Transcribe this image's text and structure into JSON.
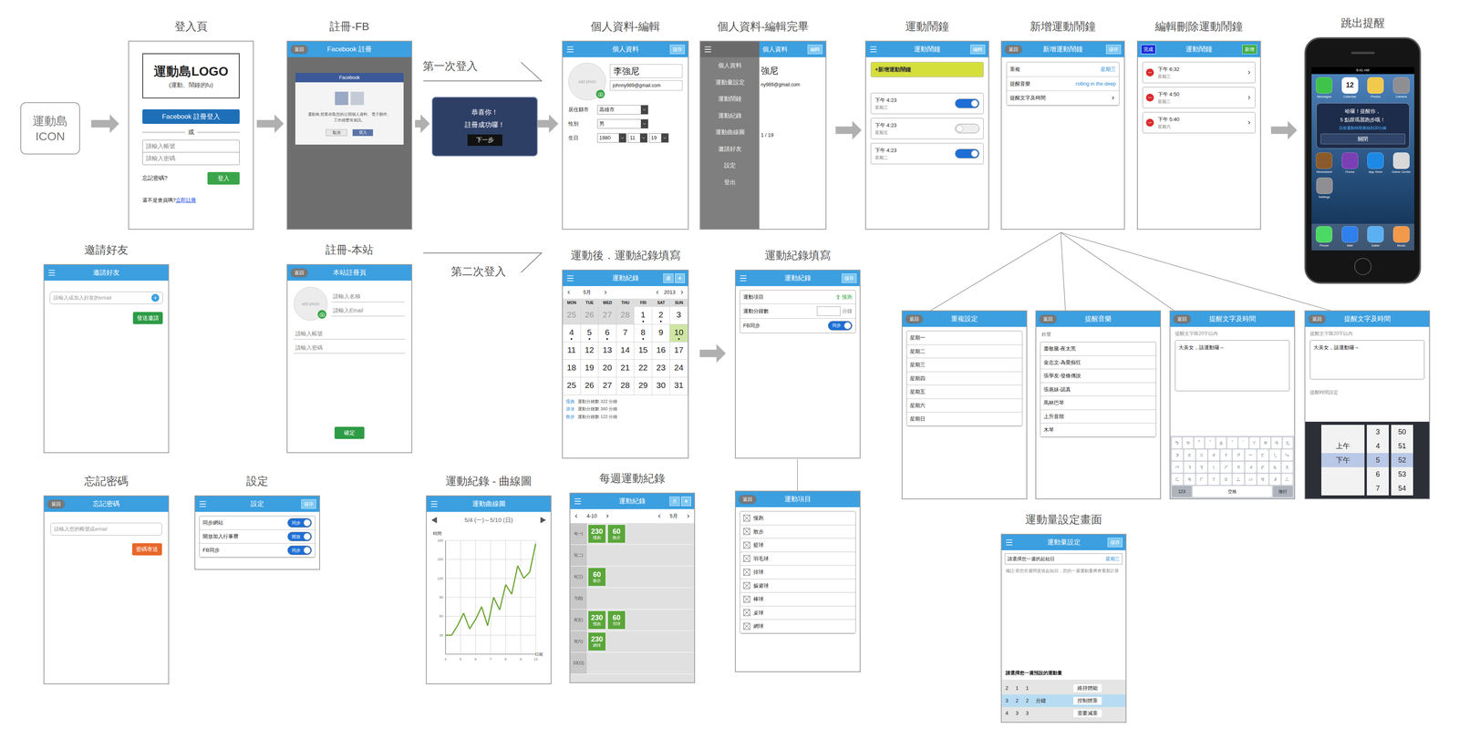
{
  "icon_box": {
    "lines": [
      "運動島",
      "ICON"
    ]
  },
  "flow_labels": [
    "第一次登入",
    "第二次登入"
  ],
  "login": {
    "caption": "登入頁",
    "logo": "運動島LOGO",
    "slogan": "(運動、鬧鐘的fu)",
    "fb_button": "Facebook 註冊登入",
    "divider": "或",
    "account_placeholder": "請輸入帳號",
    "password_placeholder": "請輸入密碼",
    "forgot": "忘記密碼?",
    "login_button": "登入",
    "not_member": "還不是會員嗎?",
    "register_link": "立即註冊"
  },
  "fb_register": {
    "caption": "註冊-FB",
    "back": "返回",
    "header": "Facebook 註冊",
    "dialog_title": "Facebook",
    "dialog_text": "運動島 想要存取您的公開個人資料、電子郵件、工作經歷等資訊。",
    "cancel": "取消",
    "confirm": "登入"
  },
  "success": {
    "lines": [
      "恭喜你！",
      "註冊成功囉！"
    ],
    "button": "下一步"
  },
  "profile_edit": {
    "caption": "個人資料-編輯",
    "header": "個人資料",
    "right_button": "儲存",
    "photo": "add photo",
    "name": "李強尼",
    "email": "johnny989@gmail.com",
    "fields": [
      {
        "label": "居住縣市",
        "value": "高雄市"
      },
      {
        "label": "性別",
        "value": "男"
      }
    ],
    "birthday_label": "生日",
    "birthday": [
      "1980",
      "11",
      "19"
    ]
  },
  "profile_done": {
    "caption": "個人資料-編輯完畢",
    "header": "個人資料",
    "right_button": "編輯",
    "menu": [
      "個人資料",
      "運動量設定",
      "運動鬧鐘",
      "運動紀錄",
      "運動曲線圖",
      "邀請好友",
      "設定",
      "登出"
    ],
    "name": "強尼",
    "email": "ny989@gmail.com",
    "birthday": "1 / 19"
  },
  "alarm": {
    "caption": "運動鬧鐘",
    "header": "運動鬧鐘",
    "right_button": "編輯",
    "add": "+新增運動鬧鐘",
    "items": [
      {
        "time": "下午 4:23",
        "day": "星期三",
        "on": true
      },
      {
        "time": "下午 4:23",
        "day": "星期五",
        "on": false
      },
      {
        "time": "下午 4:23",
        "day": "星期二",
        "on": true
      }
    ]
  },
  "alarm_new": {
    "caption": "新增運動鬧鐘",
    "back": "返回",
    "header": "新增運動鬧鐘",
    "right_button": "儲存",
    "rows": [
      {
        "label": "重複",
        "value": "星期三"
      },
      {
        "label": "提醒音樂",
        "value": "rolling in the deep"
      },
      {
        "label": "提醒文字及時間",
        "value": ""
      }
    ]
  },
  "alarm_edit": {
    "caption": "編輯刪除運動鬧鐘",
    "left_button": "完成",
    "header": "運動鬧鐘",
    "right_button": "新增",
    "items": [
      {
        "time": "下午 6:32",
        "day": "星期三"
      },
      {
        "time": "下午 4:50",
        "day": "星期二"
      },
      {
        "time": "下午 5:40",
        "day": "星期六"
      }
    ]
  },
  "popup": {
    "caption": "跳出提醒",
    "status_time": "9:41 AM",
    "apps_top": [
      {
        "label": "Messages",
        "color": "#3fc34a",
        "text": ""
      },
      {
        "label": "Calendar",
        "color": "#ffffff",
        "text": "12"
      },
      {
        "label": "Photos",
        "color": "#f2c94c",
        "text": ""
      },
      {
        "label": "Camera",
        "color": "#8e8e93",
        "text": ""
      }
    ],
    "alert": {
      "lines": [
        "哈囉！提醒你，",
        "5 點跟瑪麗跑步哦！"
      ],
      "note": "目前運動時間累積到30分鐘",
      "button": "關閉"
    },
    "apps_mid": [
      {
        "label": "Newsstand",
        "color": "#8b5a2b",
        "text": ""
      },
      {
        "label": "iTunes",
        "color": "#7b3fb5",
        "text": ""
      },
      {
        "label": "App Store",
        "color": "#1e88e5",
        "text": ""
      },
      {
        "label": "Game Center",
        "color": "#d9d9d9",
        "text": ""
      }
    ],
    "apps_bottom": [
      {
        "label": "Settings",
        "color": "#8e8e93",
        "text": ""
      }
    ],
    "dock": [
      {
        "label": "Phone",
        "color": "#4cd964",
        "text": ""
      },
      {
        "label": "Mail",
        "color": "#2f80ed",
        "text": ""
      },
      {
        "label": "Safari",
        "color": "#5ab0f0",
        "text": ""
      },
      {
        "label": "Music",
        "color": "#f2994a",
        "text": ""
      }
    ]
  },
  "invite": {
    "caption": "邀請好友",
    "header": "邀請好友",
    "placeholder": "請輸入或加入好友的email",
    "send": "發送邀請"
  },
  "register_site": {
    "caption": "註冊-本站",
    "back": "返回",
    "header": "本站註冊頁",
    "photo": "add photo",
    "fields": [
      "請輸入名稱",
      "請輸入Email",
      "請輸入帳號",
      "請輸入密碼"
    ],
    "confirm": "確定"
  },
  "calendar": {
    "caption": "運動後．運動紀錄填寫",
    "header": "運動紀錄",
    "right_button": "週",
    "add": "+",
    "month": "5月",
    "year": "2013",
    "weekdays": [
      "MON",
      "TUE",
      "WED",
      "THU",
      "FRI",
      "SAT",
      "SUN"
    ],
    "days": [
      {
        "d": "25",
        "muted": true,
        "dot": false,
        "selected": false
      },
      {
        "d": "26",
        "muted": true,
        "dot": false,
        "selected": false
      },
      {
        "d": "27",
        "muted": true,
        "dot": false,
        "selected": false
      },
      {
        "d": "28",
        "muted": true,
        "dot": false,
        "selected": false
      },
      {
        "d": "1",
        "muted": false,
        "dot": true,
        "selected": false
      },
      {
        "d": "2",
        "muted": false,
        "dot": true,
        "selected": false
      },
      {
        "d": "3",
        "muted": false,
        "dot": false,
        "selected": false
      },
      {
        "d": "4",
        "muted": false,
        "dot": true,
        "selected": false
      },
      {
        "d": "5",
        "muted": false,
        "dot": true,
        "selected": false
      },
      {
        "d": "6",
        "muted": false,
        "dot": true,
        "selected": false
      },
      {
        "d": "7",
        "muted": false,
        "dot": false,
        "selected": false
      },
      {
        "d": "8",
        "muted": false,
        "dot": true,
        "selected": false
      },
      {
        "d": "9",
        "muted": false,
        "dot": false,
        "selected": false
      },
      {
        "d": "10",
        "muted": false,
        "dot": true,
        "selected": true
      },
      {
        "d": "11",
        "muted": false,
        "dot": false,
        "selected": false
      },
      {
        "d": "12",
        "muted": false,
        "dot": false,
        "selected": false
      },
      {
        "d": "13",
        "muted": false,
        "dot": false,
        "selected": false
      },
      {
        "d": "14",
        "muted": false,
        "dot": false,
        "selected": false
      },
      {
        "d": "15",
        "muted": false,
        "dot": false,
        "selected": false
      },
      {
        "d": "16",
        "muted": false,
        "dot": false,
        "selected": false
      },
      {
        "d": "17",
        "muted": false,
        "dot": false,
        "selected": false
      },
      {
        "d": "18",
        "muted": false,
        "dot": false,
        "selected": false
      },
      {
        "d": "19",
        "muted": false,
        "dot": false,
        "selected": false
      },
      {
        "d": "20",
        "muted": false,
        "dot": false,
        "selected": false
      },
      {
        "d": "21",
        "muted": false,
        "dot": false,
        "selected": false
      },
      {
        "d": "22",
        "muted": false,
        "dot": false,
        "selected": false
      },
      {
        "d": "23",
        "muted": false,
        "dot": false,
        "selected": false
      },
      {
        "d": "24",
        "muted": false,
        "dot": false,
        "selected": false
      },
      {
        "d": "25",
        "muted": false,
        "dot": false,
        "selected": false
      },
      {
        "d": "26",
        "muted": false,
        "dot": false,
        "selected": false
      },
      {
        "d": "27",
        "muted": false,
        "dot": false,
        "selected": false
      },
      {
        "d": "28",
        "muted": false,
        "dot": false,
        "selected": false
      },
      {
        "d": "29",
        "muted": false,
        "dot": false,
        "selected": false
      },
      {
        "d": "30",
        "muted": false,
        "dot": false,
        "selected": false
      },
      {
        "d": "31",
        "muted": false,
        "dot": false,
        "selected": false
      }
    ],
    "summaries": [
      {
        "sport": "慢跑",
        "text": "運動分鐘數 322 分鐘"
      },
      {
        "sport": "游泳",
        "text": "運動分鐘數 360 分鐘"
      },
      {
        "sport": "散步",
        "text": "運動分鐘數 122 分鐘"
      }
    ]
  },
  "record_form": {
    "caption": "運動紀錄填寫",
    "header": "運動紀錄",
    "right_button": "儲存",
    "sport_label": "運動項目",
    "sport_value": "慢跑",
    "minutes_label": "運動分鐘數",
    "minutes_unit": "分鐘",
    "sync_label": "FB同步",
    "sync_toggle": "同步",
    "sync_on": true
  },
  "sport_items": {
    "back": "返回",
    "header": "運動項目",
    "items": [
      "慢跑",
      "散步",
      "籃球",
      "羽毛球",
      "排球",
      "躲避球",
      "棒球",
      "桌球",
      "網球"
    ]
  },
  "repeat": {
    "back": "返回",
    "header": "重複設定",
    "items": [
      "星期一",
      "星期二",
      "星期三",
      "星期四",
      "星期五",
      "星期六",
      "星期日"
    ]
  },
  "music": {
    "back": "返回",
    "header": "提醒音樂",
    "label": "鈴聲",
    "items": [
      "蕭敬騰-夜太黑",
      "金志文-為愛痴狂",
      "張學友-發條傳說",
      "張惠妹-認真",
      "馬林巴琴",
      "上升音階",
      "木琴"
    ]
  },
  "text_setting": {
    "back": "返回",
    "header": "提醒文字及時間",
    "hint": "提醒文字限20字以內",
    "text": "大美女，該運動囉～",
    "keys": [
      [
        "ㄅ",
        "ㄉ",
        "ˇ",
        "ˋ",
        "ㄓ",
        "ˊ",
        "˙",
        "ㄚ",
        "ㄞ",
        "ㄢ",
        "ㄦ"
      ],
      [
        "ㄆ",
        "ㄊ",
        "ㄍ",
        "ㄐ",
        "ㄔ",
        "ㄗ",
        "ㄧ",
        "ㄛ",
        "ㄟ",
        "ㄣ"
      ],
      [
        "ㄇ",
        "ㄋ",
        "ㄎ",
        "ㄑ",
        "ㄕ",
        "ㄘ",
        "ㄨ",
        "ㄜ",
        "ㄠ",
        "ㄤ"
      ],
      [
        "ㄈ",
        "ㄌ",
        "ㄏ",
        "ㄒ",
        "ㄖ",
        "ㄙ",
        "ㄩ",
        "ㄝ",
        "ㄡ",
        "ㄥ"
      ]
    ],
    "bottom_keys": [
      "123",
      "空格",
      "換行"
    ]
  },
  "time_setting": {
    "back": "返回",
    "header": "提醒文字及時間",
    "hint": "提醒文字限20字以內",
    "text": "大美女，該運動囉～",
    "time_label": "提醒時間設定",
    "ampm": [
      {
        "label": "上午",
        "selected": false
      },
      {
        "label": "下午",
        "selected": true
      }
    ],
    "hours": [
      {
        "label": "3",
        "selected": false
      },
      {
        "label": "4",
        "selected": false
      },
      {
        "label": "5",
        "selected": true
      },
      {
        "label": "6",
        "selected": false
      },
      {
        "label": "7",
        "selected": false
      }
    ],
    "minutes": [
      {
        "label": "50",
        "selected": false
      },
      {
        "label": "51",
        "selected": false
      },
      {
        "label": "52",
        "selected": true
      },
      {
        "label": "53",
        "selected": false
      },
      {
        "label": "54",
        "selected": false
      }
    ]
  },
  "workout": {
    "caption": "運動量設定畫面",
    "header": "運動量設定",
    "right_button": "儲存",
    "start_label": "請選擇您一週的起始日",
    "start_value": "星期三",
    "note": "備註:若您在週間更改起始日，您的一週運動量將會重新計算",
    "goal_label": "請選擇您一週預設的運動量",
    "rows": [
      {
        "cells": [
          "2",
          "1",
          "1"
        ],
        "unit": "",
        "label": "維持體能",
        "selected": false
      },
      {
        "cells": [
          "3",
          "2",
          "2"
        ],
        "unit": "分鐘",
        "label": "控制體重",
        "selected": true
      },
      {
        "cells": [
          "4",
          "3",
          "3"
        ],
        "unit": "",
        "label": "需要減重",
        "selected": false
      }
    ]
  },
  "forgot": {
    "caption": "忘記密碼",
    "back": "返回",
    "header": "忘記密碼",
    "placeholder": "請輸入您的帳號或email",
    "button": "密碼寄送"
  },
  "settings": {
    "caption": "設定",
    "header": "設定",
    "right_button": "儲存",
    "rows": [
      {
        "label": "同步網站",
        "toggle": "同步",
        "on": true
      },
      {
        "label": "開放加入行事曆",
        "toggle": "開放",
        "on": true
      },
      {
        "label": "FB同步",
        "toggle": "同步",
        "on": true
      }
    ]
  },
  "chart": {
    "caption": "運動紀錄 - 曲線圖",
    "header": "運動曲線圖",
    "range": "5/4 (一)～5/10 (日)",
    "y_label": "時間",
    "x_label": "日期",
    "y_ticks": [
      "180",
      "150",
      "120",
      "90",
      "60",
      "30"
    ],
    "x_ticks": [
      "4",
      "5",
      "6",
      "7",
      "8",
      "9",
      "10"
    ],
    "values": [
      30,
      30,
      45,
      65,
      40,
      55,
      75,
      45,
      90,
      70,
      110,
      95,
      140,
      120,
      130,
      175
    ]
  },
  "weekly": {
    "caption": "每週運動紀錄",
    "header": "運動紀錄",
    "right_button": "月",
    "add": "+",
    "week": "4-10",
    "month": "5月",
    "days": [
      {
        "label": "4(一)",
        "entries": [
          {
            "minutes": "230",
            "sport": "慢跑"
          },
          {
            "minutes": "60",
            "sport": "散步"
          }
        ]
      },
      {
        "label": "5(二)",
        "entries": []
      },
      {
        "label": "6(三)",
        "entries": [
          {
            "minutes": "60",
            "sport": "散步"
          }
        ]
      },
      {
        "label": "7(四)",
        "entries": []
      },
      {
        "label": "8(五)",
        "entries": [
          {
            "minutes": "230",
            "sport": "慢跑"
          },
          {
            "minutes": "60",
            "sport": "羽球"
          }
        ]
      },
      {
        "label": "9(六)",
        "entries": [
          {
            "minutes": "230",
            "sport": "網球"
          }
        ]
      },
      {
        "label": "10(日)",
        "entries": []
      }
    ]
  }
}
